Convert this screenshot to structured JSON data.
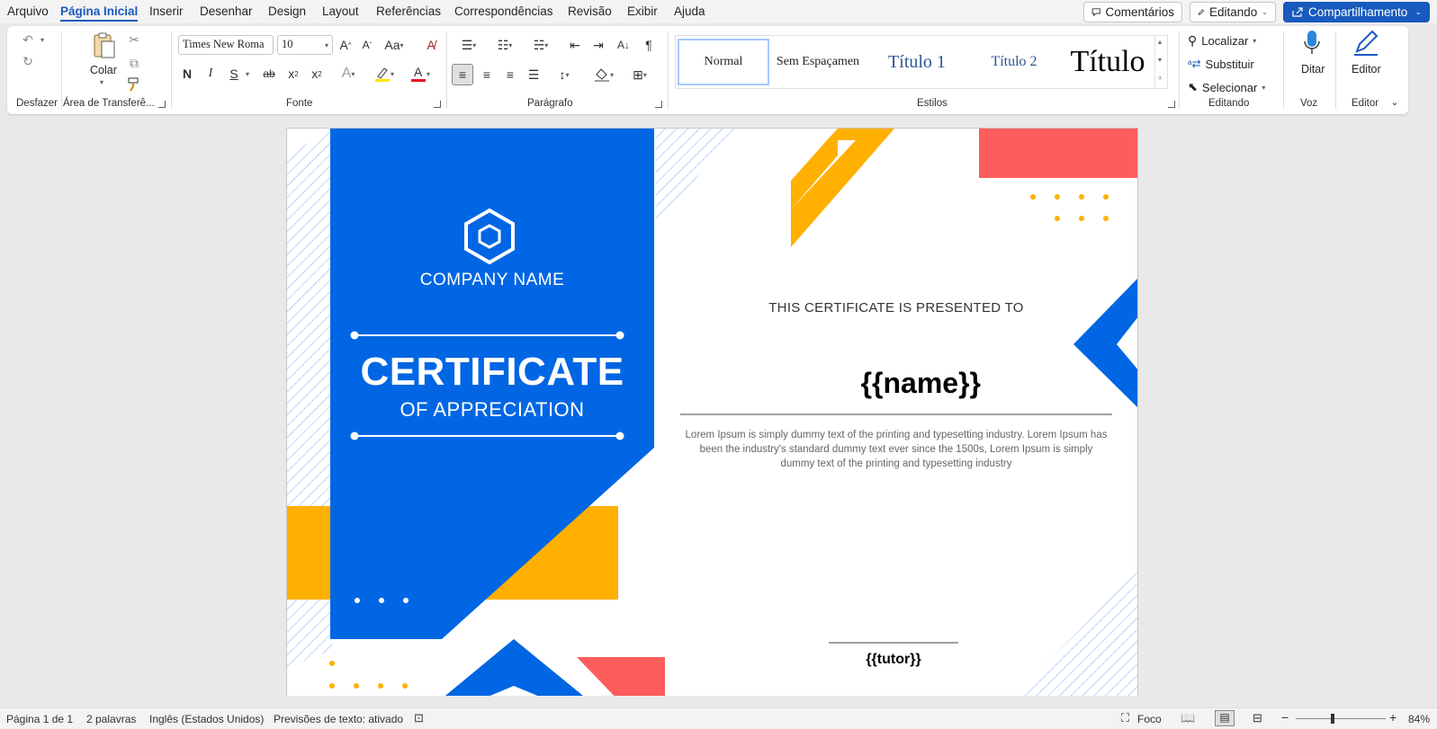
{
  "menu": {
    "tabs": [
      "Arquivo",
      "Página Inicial",
      "Inserir",
      "Desenhar",
      "Design",
      "Layout",
      "Referências",
      "Correspondências",
      "Revisão",
      "Exibir",
      "Ajuda"
    ],
    "active_tab": "Página Inicial",
    "comments_label": "Comentários",
    "editing_label": "Editando",
    "share_label": "Compartilhamento"
  },
  "ribbon": {
    "groups": {
      "undo": "Desfazer",
      "clipboard": "Área de Transferê...",
      "font": "Fonte",
      "paragraph": "Parágrafo",
      "styles": "Estilos",
      "editing": "Editando",
      "voice": "Voz",
      "editor": "Editor"
    },
    "paste_label": "Colar",
    "font_name": "Times New Roma",
    "font_size": "10",
    "styles": [
      "Normal",
      "Sem Espaçamen",
      "Título 1",
      "Título 2",
      "Título"
    ],
    "find_label": "Localizar",
    "replace_label": "Substituir",
    "select_label": "Selecionar",
    "dictate_label": "Ditar",
    "editor_label": "Editor",
    "bold_glyph": "N",
    "italic_glyph": "I",
    "underline_glyph": "S"
  },
  "certificate": {
    "company": "COMPANY NAME",
    "title": "CERTIFICATE",
    "subtitle": "OF APPRECIATION",
    "presented_to": "THIS CERTIFICATE IS PRESENTED TO",
    "name_placeholder": "{{name}}",
    "body_text": "Lorem Ipsum is simply dummy text of the printing and typesetting industry. Lorem Ipsum has been the industry's standard dummy text ever since the 1500s, Lorem Ipsum is simply dummy text of the printing and typesetting industry",
    "tutor_placeholder": "{{tutor}}",
    "colors": {
      "blue": "#0066e3",
      "yellow": "#ffb000",
      "red": "#ff5c5c"
    }
  },
  "status": {
    "page": "Página 1 de 1",
    "words": "2 palavras",
    "language": "Inglês (Estados Unidos)",
    "predictions": "Previsões de texto: ativado",
    "focus": "Foco",
    "zoom": "84%"
  }
}
